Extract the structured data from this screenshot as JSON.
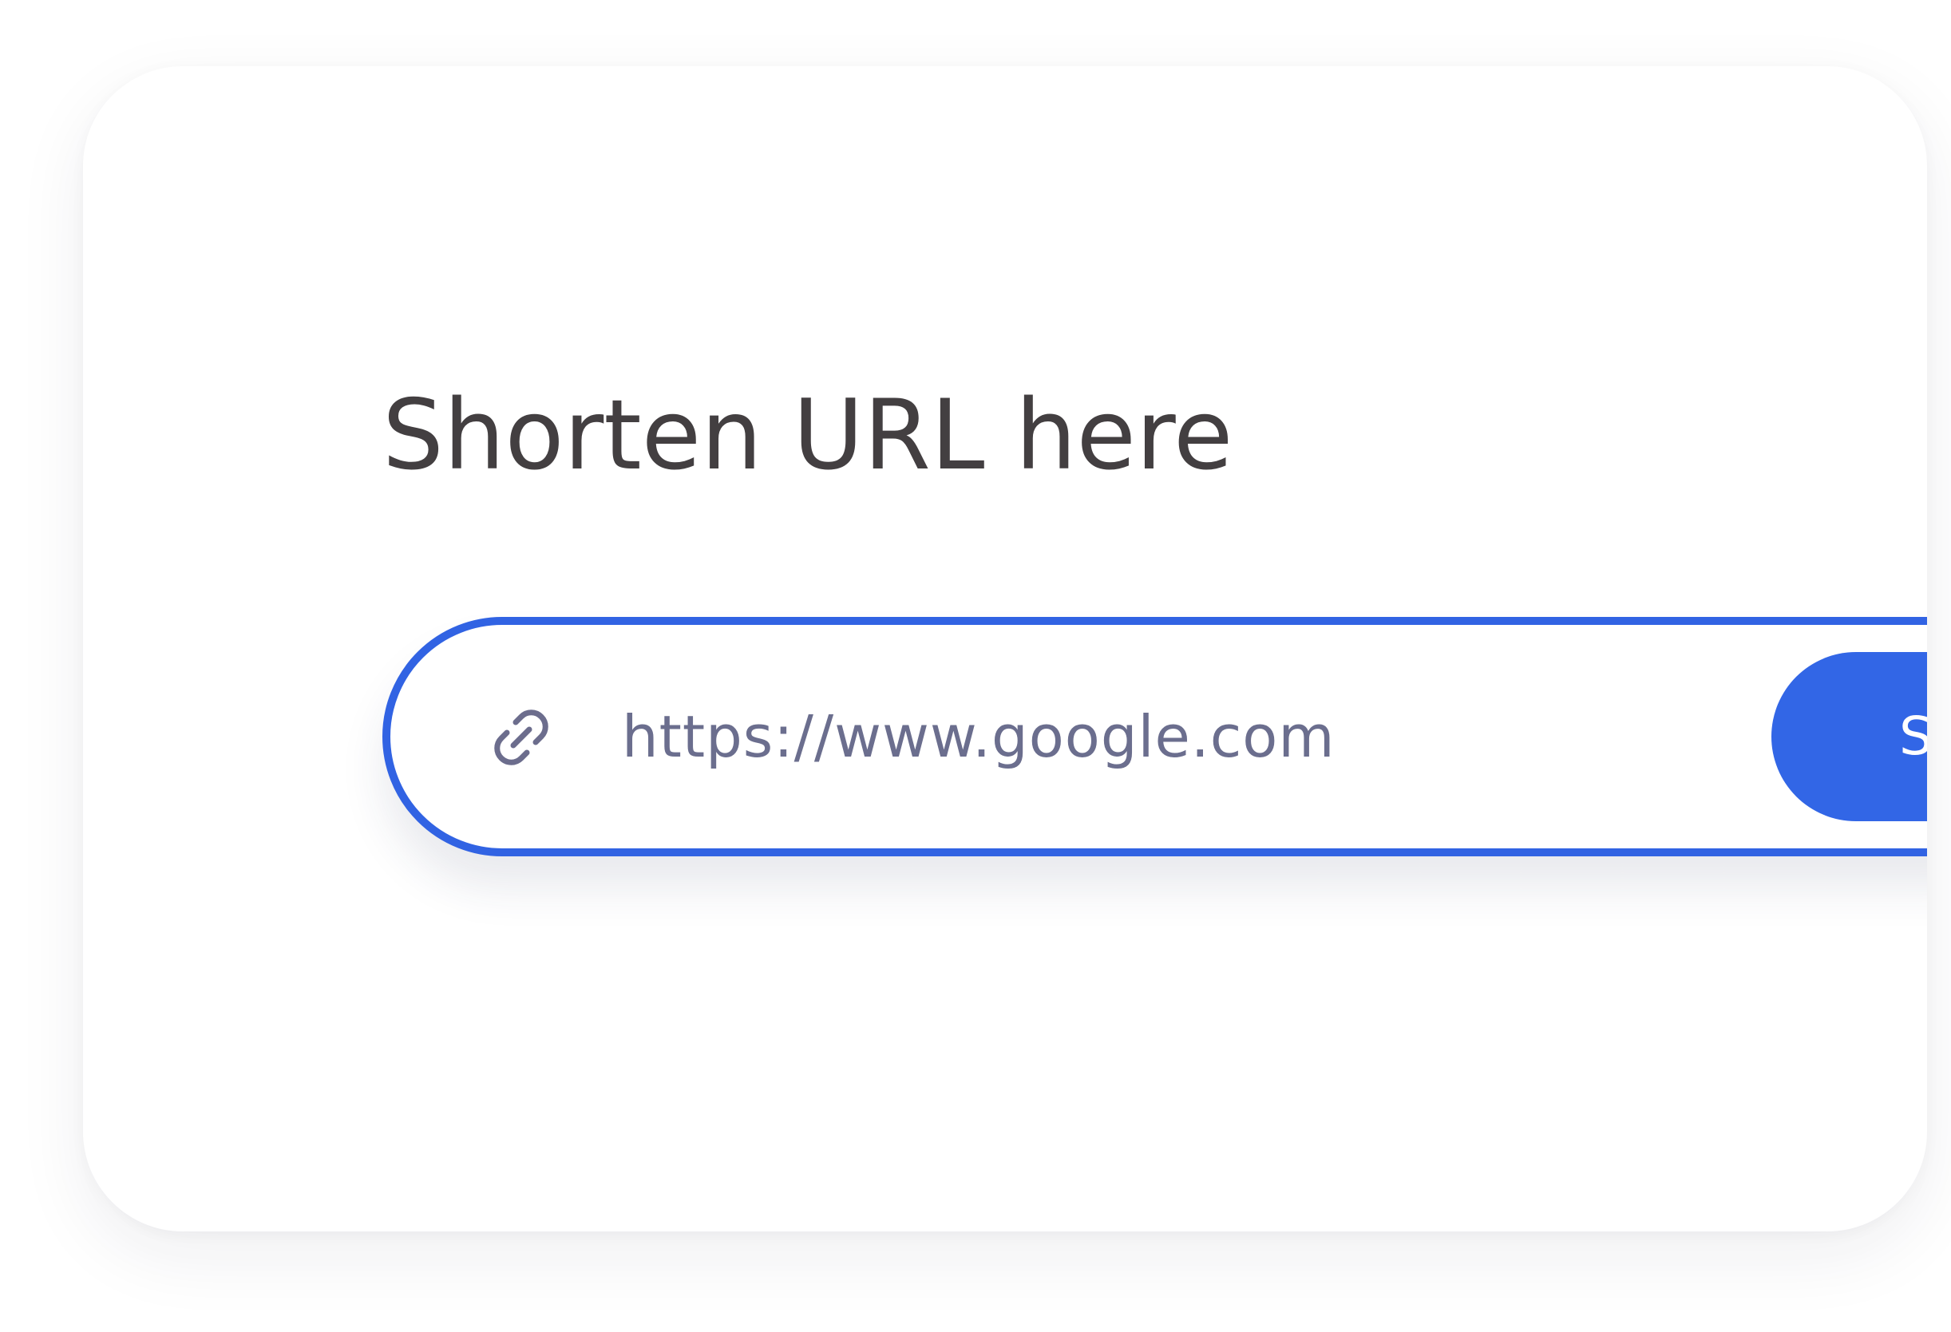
{
  "header": {
    "title": "Shorten URL here"
  },
  "url_form": {
    "input_value": "https://www.google.com",
    "link_icon": "link-icon",
    "button_label": "Shor"
  },
  "colors": {
    "accent": "#3266e6",
    "title_text": "#433f41",
    "input_text": "#6b6e8e",
    "background": "#ffffff"
  }
}
